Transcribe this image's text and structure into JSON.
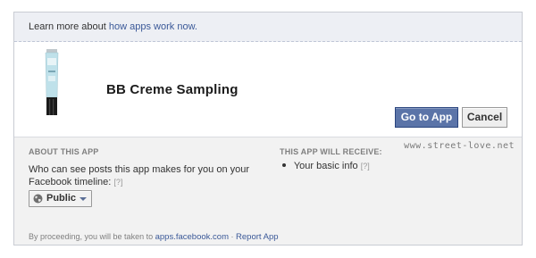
{
  "top_bar": {
    "prefix": "Learn more about",
    "link": "how apps work now."
  },
  "header": {
    "app_name": "BB Creme Sampling",
    "go_button": "Go to App",
    "cancel_button": "Cancel"
  },
  "about": {
    "title": "ABOUT THIS APP",
    "timeline_text": "Who can see posts this app makes for you on your Facebook timeline:",
    "help": "[?]",
    "privacy_value": "Public"
  },
  "receive": {
    "title": "THIS APP WILL RECEIVE:",
    "items": [
      {
        "label": "Your basic info",
        "help": "[?]"
      }
    ]
  },
  "watermark": "www.street-love.net",
  "footer": {
    "prefix": "By proceeding, you will be taken to",
    "domain_link": "apps.facebook.com",
    "separator": "·",
    "report_link": "Report App"
  }
}
